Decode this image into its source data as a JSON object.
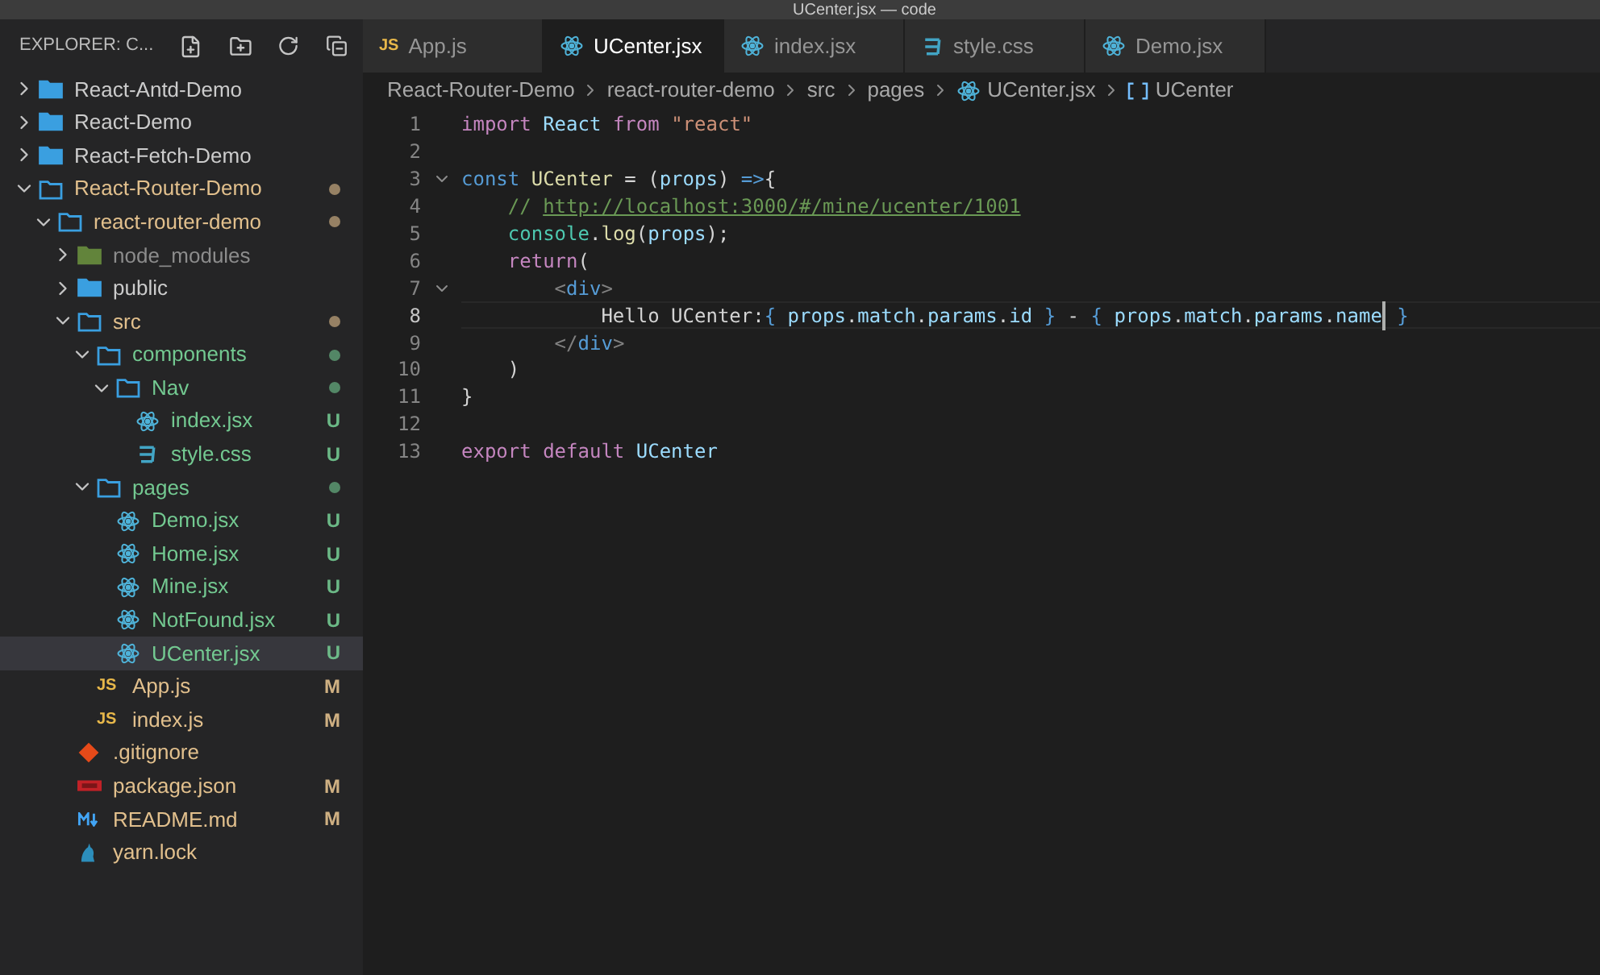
{
  "window": {
    "title": "UCenter.jsx — code"
  },
  "explorer": {
    "title": "EXPLORER: C...",
    "tree": [
      {
        "name": "React-Antd-Demo",
        "kind": "folder",
        "expanded": false,
        "color": "#cccccc",
        "selected": false
      },
      {
        "name": "React-Demo",
        "kind": "folder",
        "expanded": false,
        "color": "#cccccc",
        "selected": false
      },
      {
        "name": "React-Fetch-Demo",
        "kind": "folder",
        "expanded": false,
        "color": "#cccccc",
        "selected": false
      },
      {
        "name": "React-Router-Demo",
        "kind": "folder",
        "expanded": true,
        "color": "#e2c08d",
        "dot": true,
        "selected": false,
        "children": [
          {
            "name": "react-router-demo",
            "kind": "folder",
            "expanded": true,
            "color": "#e2c08d",
            "dot": true,
            "selected": false,
            "children": [
              {
                "name": "node_modules",
                "kind": "node",
                "expanded": false,
                "color": "#8c8c8c",
                "selected": false
              },
              {
                "name": "public",
                "kind": "folder",
                "expanded": false,
                "color": "#cccccc",
                "selected": false
              },
              {
                "name": "src",
                "kind": "folder",
                "expanded": true,
                "color": "#e2c08d",
                "dot": true,
                "selected": false,
                "children": [
                  {
                    "name": "components",
                    "kind": "folder",
                    "expanded": true,
                    "color": "#73c991",
                    "dot": true,
                    "selected": false,
                    "children": [
                      {
                        "name": "Nav",
                        "kind": "folder",
                        "expanded": true,
                        "color": "#73c991",
                        "dot": true,
                        "selected": false,
                        "children": [
                          {
                            "name": "index.jsx",
                            "kind": "react",
                            "color": "#73c991",
                            "badge": "U",
                            "selected": false
                          },
                          {
                            "name": "style.css",
                            "kind": "css",
                            "color": "#73c991",
                            "badge": "U",
                            "selected": false
                          }
                        ]
                      }
                    ]
                  },
                  {
                    "name": "pages",
                    "kind": "folder",
                    "expanded": true,
                    "color": "#73c991",
                    "dot": true,
                    "selected": false,
                    "children": [
                      {
                        "name": "Demo.jsx",
                        "kind": "react",
                        "color": "#73c991",
                        "badge": "U",
                        "selected": false
                      },
                      {
                        "name": "Home.jsx",
                        "kind": "react",
                        "color": "#73c991",
                        "badge": "U",
                        "selected": false
                      },
                      {
                        "name": "Mine.jsx",
                        "kind": "react",
                        "color": "#73c991",
                        "badge": "U",
                        "selected": false
                      },
                      {
                        "name": "NotFound.jsx",
                        "kind": "react",
                        "color": "#73c991",
                        "badge": "U",
                        "selected": false
                      },
                      {
                        "name": "UCenter.jsx",
                        "kind": "react",
                        "color": "#73c991",
                        "badge": "U",
                        "selected": true
                      }
                    ]
                  },
                  {
                    "name": "App.js",
                    "kind": "js",
                    "icon_label": "JS",
                    "color": "#e2c08d",
                    "badge": "M",
                    "selected": false
                  },
                  {
                    "name": "index.js",
                    "kind": "js",
                    "icon_label": "JS",
                    "color": "#e2c08d",
                    "badge": "M",
                    "selected": false
                  }
                ]
              },
              {
                "name": ".gitignore",
                "kind": "git",
                "color": "#e2c08d",
                "selected": false
              },
              {
                "name": "package.json",
                "kind": "npm",
                "color": "#e2c08d",
                "badge": "M",
                "selected": false
              },
              {
                "name": "README.md",
                "kind": "md",
                "color": "#e2c08d",
                "badge": "M",
                "selected": false
              },
              {
                "name": "yarn.lock",
                "kind": "yarn",
                "color": "#e2c08d",
                "selected": false
              }
            ]
          }
        ]
      }
    ]
  },
  "tabs": [
    {
      "label": "App.js",
      "kind": "js",
      "icon_label": "JS",
      "selected": false
    },
    {
      "label": "UCenter.jsx",
      "kind": "react",
      "selected": true
    },
    {
      "label": "index.jsx",
      "kind": "react",
      "selected": false
    },
    {
      "label": "style.css",
      "kind": "css",
      "selected": false
    },
    {
      "label": "Demo.jsx",
      "kind": "react",
      "selected": false
    }
  ],
  "breadcrumb": [
    {
      "label": "React-Router-Demo",
      "kind": "folder"
    },
    {
      "label": "react-router-demo",
      "kind": "folder"
    },
    {
      "label": "src",
      "kind": "folder"
    },
    {
      "label": "pages",
      "kind": "folder"
    },
    {
      "label": "UCenter.jsx",
      "kind": "react"
    },
    {
      "label": "UCenter",
      "kind": "symbol"
    }
  ],
  "editor": {
    "lines": [
      {
        "number": "1",
        "current": false,
        "tokens": [
          {
            "t": "import",
            "kind": "kw"
          },
          {
            "t": " React ",
            "kind": "var"
          },
          {
            "t": "from",
            "kind": "kw"
          },
          {
            "t": " \"react\"",
            "kind": "str"
          }
        ]
      },
      {
        "number": "2",
        "current": false
      },
      {
        "number": "3",
        "current": false,
        "fold": true,
        "tokens": [
          {
            "t": "const",
            "kind": "decl"
          },
          {
            "t": " UCenter",
            "kind": "fn"
          },
          {
            "t": " = (",
            "kind": "punct"
          },
          {
            "t": "props",
            "kind": "var"
          },
          {
            "t": ") ",
            "kind": "punct"
          },
          {
            "t": "=>",
            "kind": "decl"
          },
          {
            "t": "{",
            "kind": "punct"
          }
        ]
      },
      {
        "number": "4",
        "current": false,
        "tokens": [
          {
            "t": "    // ",
            "kind": "comment"
          },
          {
            "t": "http://localhost:3000/#/mine/ucenter/1001",
            "kind": "link"
          }
        ]
      },
      {
        "number": "5",
        "current": false,
        "tokens": [
          {
            "t": "    console",
            "kind": "type"
          },
          {
            "t": ".",
            "kind": "punct"
          },
          {
            "t": "log",
            "kind": "fn"
          },
          {
            "t": "(",
            "kind": "punct"
          },
          {
            "t": "props",
            "kind": "var"
          },
          {
            "t": ");",
            "kind": "punct"
          }
        ]
      },
      {
        "number": "6",
        "current": false,
        "tokens": [
          {
            "t": "    return",
            "kind": "kw"
          },
          {
            "t": "(",
            "kind": "punct"
          }
        ]
      },
      {
        "number": "7",
        "current": false,
        "fold": true,
        "tokens": [
          {
            "t": "        <",
            "kind": "tag"
          },
          {
            "t": "div",
            "kind": "decl"
          },
          {
            "t": ">",
            "kind": "tag"
          }
        ]
      },
      {
        "number": "8",
        "current": true,
        "tokens": [
          {
            "t": "            Hello UCenter:",
            "kind": "punct"
          },
          {
            "t": "{",
            "kind": "decl"
          },
          {
            "t": " props",
            "kind": "var"
          },
          {
            "t": ".",
            "kind": "punct"
          },
          {
            "t": "match",
            "kind": "var"
          },
          {
            "t": ".",
            "kind": "punct"
          },
          {
            "t": "params",
            "kind": "var"
          },
          {
            "t": ".",
            "kind": "punct"
          },
          {
            "t": "id ",
            "kind": "var"
          },
          {
            "t": "}",
            "kind": "decl"
          },
          {
            "t": " - ",
            "kind": "punct"
          },
          {
            "t": "{",
            "kind": "decl"
          },
          {
            "t": " props",
            "kind": "var"
          },
          {
            "t": ".",
            "kind": "punct"
          },
          {
            "t": "match",
            "kind": "var"
          },
          {
            "t": ".",
            "kind": "punct"
          },
          {
            "t": "params",
            "kind": "var"
          },
          {
            "t": ".",
            "kind": "punct"
          },
          {
            "t": "name",
            "kind": "var",
            "cursor": true
          },
          {
            "t": " }",
            "kind": "decl"
          }
        ]
      },
      {
        "number": "9",
        "current": false,
        "tokens": [
          {
            "t": "        </",
            "kind": "tag"
          },
          {
            "t": "div",
            "kind": "decl"
          },
          {
            "t": ">",
            "kind": "tag"
          }
        ]
      },
      {
        "number": "10",
        "current": false,
        "tokens": [
          {
            "t": "    )",
            "kind": "punct"
          }
        ]
      },
      {
        "number": "11",
        "current": false,
        "tokens": [
          {
            "t": "}",
            "kind": "punct"
          }
        ]
      },
      {
        "number": "12",
        "current": false
      },
      {
        "number": "13",
        "current": false,
        "tokens": [
          {
            "t": "export",
            "kind": "kw"
          },
          {
            "t": " default",
            "kind": "kw"
          },
          {
            "t": " UCenter",
            "kind": "var"
          }
        ]
      }
    ]
  }
}
